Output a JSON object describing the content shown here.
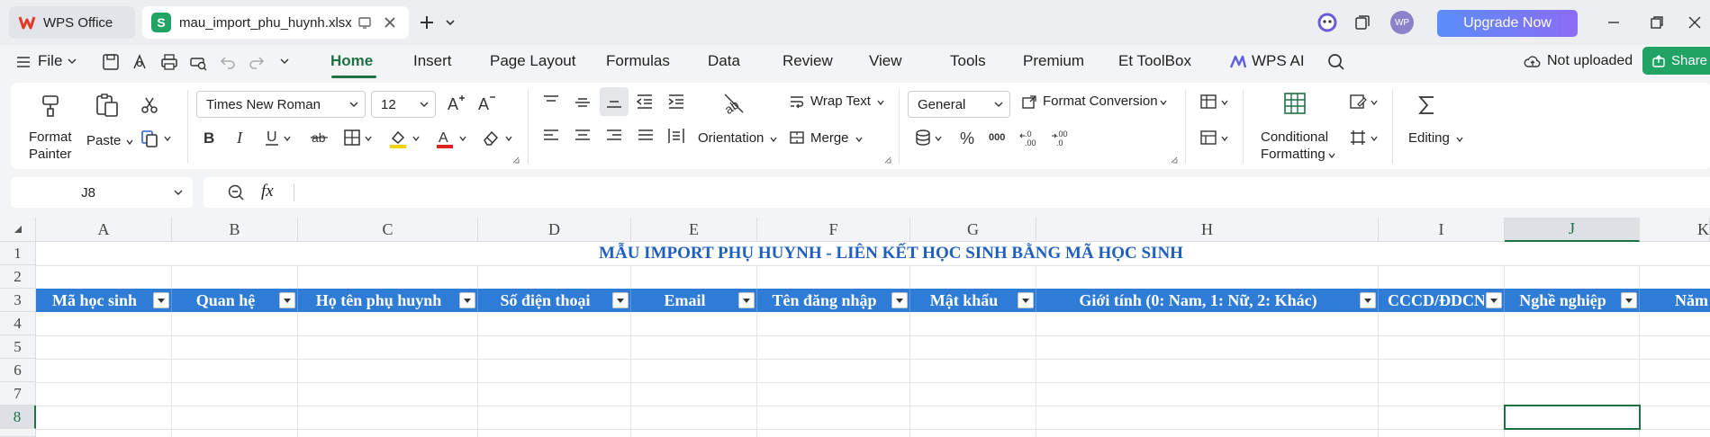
{
  "window": {
    "tabs": [
      {
        "label": "WPS Office",
        "icon": "wps-logo-icon"
      },
      {
        "label": "mau_import_phu_huynh.xlsx",
        "icon": "spreadsheet-s-icon",
        "logo_letter": "S"
      }
    ],
    "avatar_initials": "WP",
    "upgrade_label": "Upgrade Now"
  },
  "menu": {
    "file_label": "File",
    "tabs": [
      "Home",
      "Insert",
      "Page Layout",
      "Formulas",
      "Data",
      "Review",
      "View",
      "Tools",
      "Premium",
      "Et ToolBox"
    ],
    "wps_ai_label": "WPS AI",
    "not_uploaded_label": "Not uploaded",
    "share_label": "Share"
  },
  "ribbon": {
    "format_painter_line1": "Format",
    "format_painter_line2": "Painter",
    "paste_label": "Paste",
    "font_name": "Times New Roman",
    "font_size": "12",
    "wrap_text_label": "Wrap Text",
    "orientation_label": "Orientation",
    "merge_label": "Merge",
    "number_format": "General",
    "format_conversion_label": "Format Conversion",
    "conditional_line1": "Conditional",
    "conditional_line2": "Formatting",
    "editing_label": "Editing",
    "colors": {
      "highlight": "#f5d20a",
      "font_color": "#e02020"
    }
  },
  "formula_bar": {
    "name_box": "J8",
    "fx_label": "fx",
    "content": ""
  },
  "sheet": {
    "columns": [
      "A",
      "B",
      "C",
      "D",
      "E",
      "F",
      "G",
      "H",
      "I",
      "J",
      "K"
    ],
    "selected_column": "J",
    "rows": [
      "1",
      "2",
      "3",
      "4",
      "5",
      "6",
      "7",
      "8"
    ],
    "selected_row": "8",
    "title": "MẪU IMPORT PHỤ HUYNH - LIÊN KẾT HỌC SINH BẰNG MÃ HỌC SINH",
    "headers": [
      "Mã học sinh",
      "Quan hệ",
      "Họ tên phụ huynh",
      "Số điện thoại",
      "Email",
      "Tên đăng nhập",
      "Mật khẩu",
      "Giới tính (0: Nam, 1: Nữ, 2: Khác)",
      "CCCD/ĐDCN",
      "Nghề nghiệp",
      "Năm"
    ],
    "header_color": "#2f7cd6",
    "title_color": "#1f5fbf"
  }
}
